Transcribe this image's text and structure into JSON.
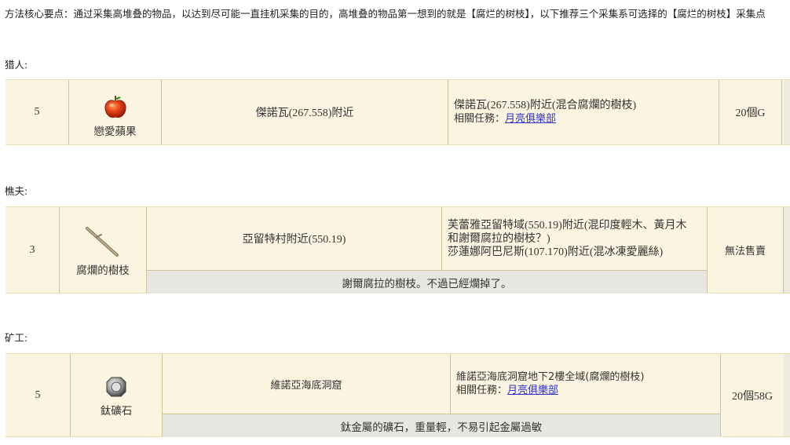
{
  "intro": "方法核心要点：通过采集高堆叠的物品，以达到尽可能一直挂机采集的目的，高堆叠的物品第一想到的就是【腐烂的树枝】，以下推荐三个采集系可选择的【腐烂的树枝】采集点",
  "sections": [
    {
      "label": "猎人:",
      "level": "5",
      "item_name": "戀愛蘋果",
      "item_icon": "red-apple-icon",
      "location": "傑諾瓦(267.558)附近",
      "detail_lines": [
        "傑諾瓦(267.558)附近(混合腐爛的樹枝)"
      ],
      "quest_label": "相關任務：",
      "quest_link": "月亮俱樂部",
      "price": "20個G",
      "description": ""
    },
    {
      "label": "樵夫:",
      "level": "3",
      "item_name": "腐爛的樹枝",
      "item_icon": "rotten-branch-icon",
      "location": "亞留特村附近(550.19)",
      "detail_lines": [
        "芙蕾雅亞留特域(550.19)附近(混印度輕木、黃月木",
        "和謝爾腐拉的樹枝？)",
        "莎蓮娜阿巴尼斯(107.170)附近(混冰凍愛麗絲)"
      ],
      "quest_label": "",
      "quest_link": "",
      "price": "無法售賣",
      "description": "謝爾腐拉的樹枝。不過已經爛掉了。"
    },
    {
      "label": "矿工:",
      "level": "5",
      "item_name": "鈦礦石",
      "item_icon": "titanium-ore-icon",
      "location": "維諾亞海底洞窟",
      "detail_lines": [
        "維諾亞海底洞窟地下2樓全域(腐爛的樹枝)"
      ],
      "quest_label": "相關任務：",
      "quest_link": "月亮俱樂部",
      "price": "20個58G",
      "description": "鈦金屬的礦石，重量輕，不易引起金屬過敏"
    }
  ],
  "colors": {
    "card_bg": "#fbf4e0",
    "desc_bg": "#e8e6e0",
    "link": "#3333cc",
    "apple": "#d93a10"
  }
}
